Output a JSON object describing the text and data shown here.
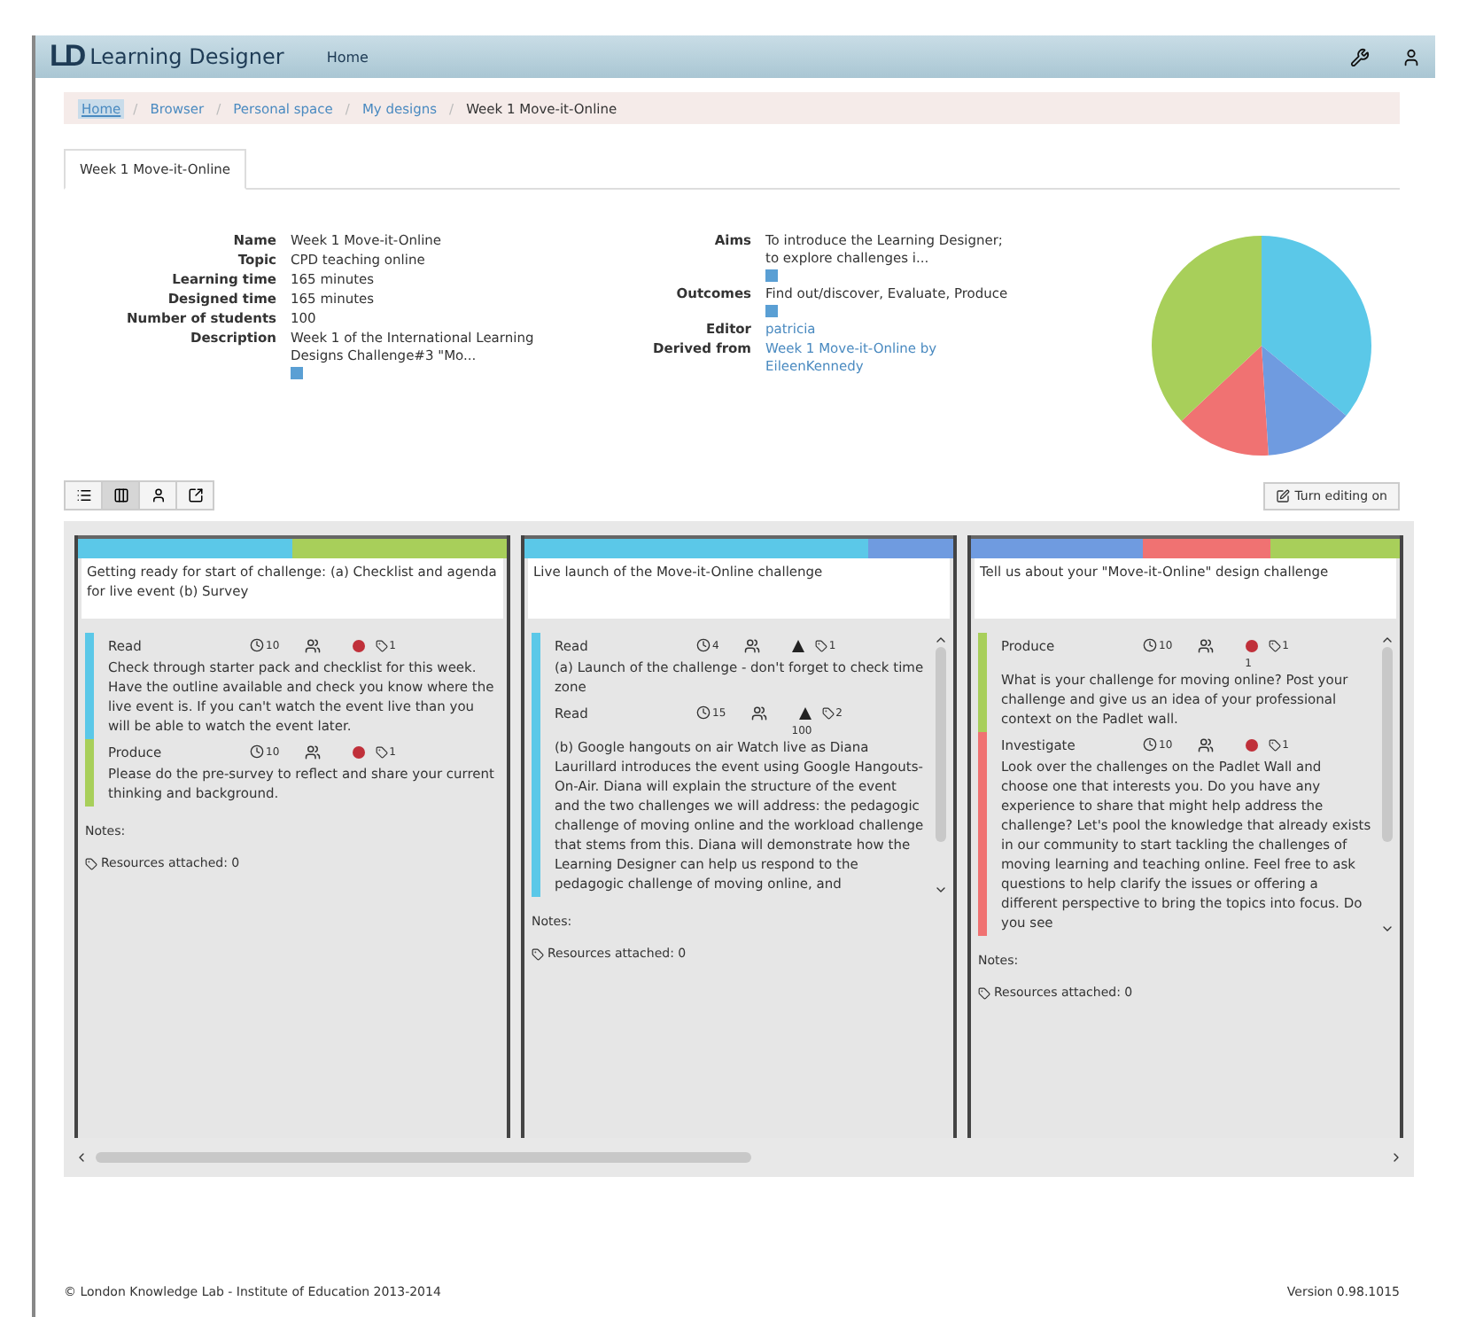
{
  "navbar": {
    "logo": "LD",
    "brand": "Learning Designer",
    "items": [
      {
        "label": "Home",
        "selected": false
      }
    ]
  },
  "breadcrumb": {
    "separator": "/",
    "items": [
      {
        "label": "Home",
        "selected": true,
        "kind": "link"
      },
      {
        "label": "Browser",
        "selected": false,
        "kind": "link"
      },
      {
        "label": "Personal space",
        "selected": false,
        "kind": "link"
      },
      {
        "label": "My designs",
        "selected": false,
        "kind": "link"
      },
      {
        "label": "Week 1 Move-it-Online",
        "selected": false,
        "kind": "current"
      }
    ]
  },
  "tabs": [
    {
      "label": "Week 1 Move-it-Online",
      "selected": true
    }
  ],
  "details_left": [
    {
      "label": "Name",
      "value": "Week 1 Move-it-Online",
      "kind": "text"
    },
    {
      "label": "Topic",
      "value": "CPD teaching online",
      "kind": "text"
    },
    {
      "label": "Learning time",
      "value": "165 minutes",
      "kind": "text"
    },
    {
      "label": "Designed time",
      "value": "165 minutes",
      "kind": "text"
    },
    {
      "label": "Number of students",
      "value": "100",
      "kind": "text"
    },
    {
      "label": "Description",
      "value": "Week 1 of the International Learning Designs Challenge#3 \"Mo...",
      "kind": "more"
    }
  ],
  "details_right": [
    {
      "label": "Aims",
      "value": "To introduce the Learning Designer; to explore challenges i...",
      "kind": "more_below"
    },
    {
      "label": "Outcomes",
      "value": "Find out/discover, Evaluate, Produce",
      "kind": "more"
    },
    {
      "label": "Editor",
      "value": "patricia",
      "kind": "link"
    },
    {
      "label": "Derived from",
      "value": "Week 1 Move-it-Online by EileenKennedy",
      "kind": "link"
    }
  ],
  "pie": [
    {
      "color": "#5bc8e8"
    },
    {
      "color": "#6f9be0"
    },
    {
      "color": "#f07272"
    },
    {
      "color": "#a8cf5a"
    }
  ],
  "toolbar": {
    "views": [
      {
        "kind": "list",
        "selected": false
      },
      {
        "kind": "columns",
        "selected": true
      },
      {
        "kind": "person",
        "selected": false
      },
      {
        "kind": "export",
        "selected": false
      }
    ],
    "edit_button": "Turn editing on"
  },
  "columns": [
    {
      "bar": [
        {
          "color": "#5bc8e8"
        },
        {
          "color": "#a8cf5a"
        }
      ],
      "title": "Getting ready for start of challenge: (a) Checklist and agenda for live event (b) Survey",
      "scroll": false,
      "activities": [
        {
          "type": "Read",
          "color": "#5bc8e8",
          "minutes": "10",
          "kind": "dot",
          "resources": "1",
          "text": "Check through starter pack and checklist for this week. Have the outline available and check you know where the live event is. If you can't watch the event live than you will be able to watch the event later."
        },
        {
          "type": "Produce",
          "color": "#a8cf5a",
          "minutes": "10",
          "kind": "dot",
          "resources": "1",
          "text": "Please do the pre-survey to reflect and share your current thinking and background."
        }
      ],
      "notes": "Notes:",
      "resources": "Resources attached: 0"
    },
    {
      "bar": [
        {
          "color": "#5bc8e8"
        },
        {
          "color": "#6f9be0"
        }
      ],
      "title": "Live launch of the Move-it-Online challenge",
      "scroll": true,
      "activities": [
        {
          "type": "Read",
          "color": "#5bc8e8",
          "minutes": "4",
          "kind": "triangle",
          "resources": "1",
          "text": "(a) Launch of the challenge - don't forget to check time zone"
        },
        {
          "type": "Read",
          "color": "#5bc8e8",
          "minutes": "15",
          "kind": "triangle",
          "resources": "2",
          "group_size": "100",
          "text": "(b) Google hangouts on air Watch live as Diana Laurillard introduces the event using Google Hangouts-On-Air. Diana will explain the structure of the event and the two challenges we will address: the pedagogic challenge of moving online and the workload challenge that stems from this. Diana will demonstrate how the Learning Designer can help us respond to the pedagogic challenge of moving online, and"
        }
      ],
      "notes": "Notes:",
      "resources": "Resources attached: 0"
    },
    {
      "bar": [
        {
          "color": "#6f9be0"
        },
        {
          "color": "#f07272"
        },
        {
          "color": "#a8cf5a"
        }
      ],
      "title": "Tell us about your \"Move-it-Online\" design challenge",
      "scroll": true,
      "activities": [
        {
          "type": "Produce",
          "color": "#a8cf5a",
          "minutes": "10",
          "kind": "dot",
          "resources": "1",
          "group_size": "1",
          "text": "What is your challenge for moving online? Post your challenge and give us an idea of your professional context on the Padlet wall."
        },
        {
          "type": "Investigate",
          "color": "#f07272",
          "minutes": "10",
          "kind": "dot",
          "resources": "1",
          "text": "Look over the challenges on the Padlet Wall and choose one that interests you. Do you have any experience to share that might help address the challenge? Let's pool the knowledge that already exists in our community to start tackling the challenges of moving learning and teaching online. Feel free to ask questions to help clarify the issues or offering a different perspective to bring the topics into focus. Do you see"
        }
      ],
      "notes": "Notes:",
      "resources": "Resources attached: 0"
    }
  ],
  "footer": {
    "copyright": "© London Knowledge Lab - Institute of Education 2013-2014",
    "version": "Version 0.98.1015"
  }
}
